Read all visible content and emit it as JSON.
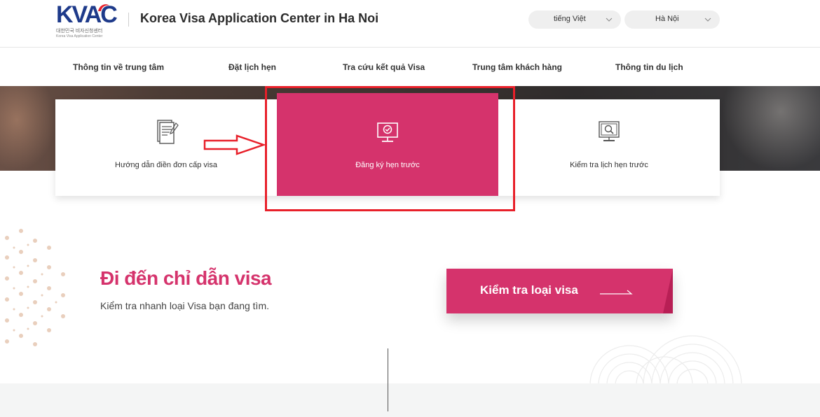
{
  "header": {
    "logo_text": "KVAC",
    "logo_subtitle_ko": "대한민국 비자신청센터",
    "logo_subtitle_en": "Korea Visa Application Center",
    "site_title": "Korea Visa Application Center in Ha Noi",
    "language": "tiếng Việt",
    "city": "Hà Nội"
  },
  "nav": {
    "items": [
      {
        "label": "Thông tin về trung tâm"
      },
      {
        "label": "Đặt lịch hẹn"
      },
      {
        "label": "Tra cứu kết quả Visa"
      },
      {
        "label": "Trung tâm khách hàng"
      },
      {
        "label": "Thông tin du lịch"
      }
    ]
  },
  "cards": [
    {
      "label": "Hướng dẫn điền đơn cấp visa",
      "icon": "document-icon"
    },
    {
      "label": "Đăng ký hẹn trước",
      "icon": "monitor-check-icon"
    },
    {
      "label": "Kiểm tra lịch hẹn trước",
      "icon": "monitor-search-icon"
    }
  ],
  "guide": {
    "title": "Đi đến chỉ dẫn visa",
    "subtitle": "Kiểm tra nhanh loại Visa bạn đang tìm.",
    "button_label": "Kiểm tra loại visa"
  },
  "colors": {
    "brand_pink": "#d5336c",
    "brand_navy": "#1e3a8a",
    "annotation_red": "#e8202a"
  }
}
